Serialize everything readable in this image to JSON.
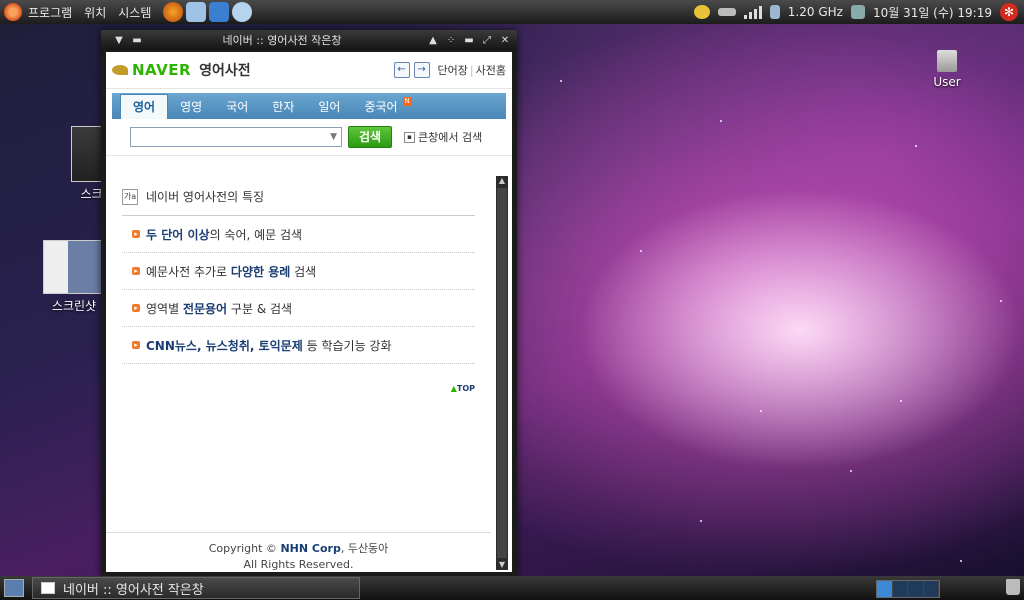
{
  "top_panel": {
    "menus": [
      "프로그램",
      "위치",
      "시스템"
    ],
    "cpu_freq": "1.20 GHz",
    "clock": "10월 31일 (수) 19:19"
  },
  "desktop": {
    "icons": [
      {
        "label": "스크린"
      },
      {
        "label": "스크린샷"
      },
      {
        "label": "User"
      }
    ]
  },
  "window": {
    "title": "네이버 :: 영어사전 작은창",
    "header": {
      "logo": "NAVER",
      "dict_title": "영어사전",
      "back_arrow": "←",
      "forward_arrow": "→",
      "link_wordbook": "단어장",
      "link_home": "사전홈"
    },
    "tabs": [
      {
        "label": "영어",
        "active": true
      },
      {
        "label": "영영"
      },
      {
        "label": "국어"
      },
      {
        "label": "한자"
      },
      {
        "label": "일어"
      },
      {
        "label": "중국어",
        "badge": "N"
      }
    ],
    "search": {
      "value": "",
      "button": "검색",
      "bigwindow_label": "큰창에서 검색"
    },
    "features": {
      "icon_text": "가a",
      "title": "네이버 영어사전의 특징",
      "items": [
        {
          "hl1": "두 단어 이상",
          "text1": "의 숙어, 예문 검색",
          "hl2": "",
          "text2": ""
        },
        {
          "text0": "예문사전 추가로 ",
          "hl1": "다양한 용례",
          "text1": " 검색"
        },
        {
          "text0": "영역별 ",
          "hl1": "전문용어",
          "text1": " 구분 & 검색"
        },
        {
          "hl1": "CNN뉴스, 뉴스청취, 토익문제",
          "text1": " 등 학습기능 강화"
        }
      ],
      "top_link": "TOP"
    },
    "footer": {
      "copyright_prefix": "Copyright ©",
      "brand": "NHN Corp",
      "suffix": ", 두산동아",
      "line2": "All Rights Reserved."
    }
  },
  "bottom_panel": {
    "task_label": "네이버 :: 영어사전 작은창"
  },
  "colors": {
    "naver_green": "#2db400",
    "tab_blue": "#4a86b7",
    "highlight_navy": "#1a3e73",
    "bullet_orange": "#f07a2a"
  }
}
